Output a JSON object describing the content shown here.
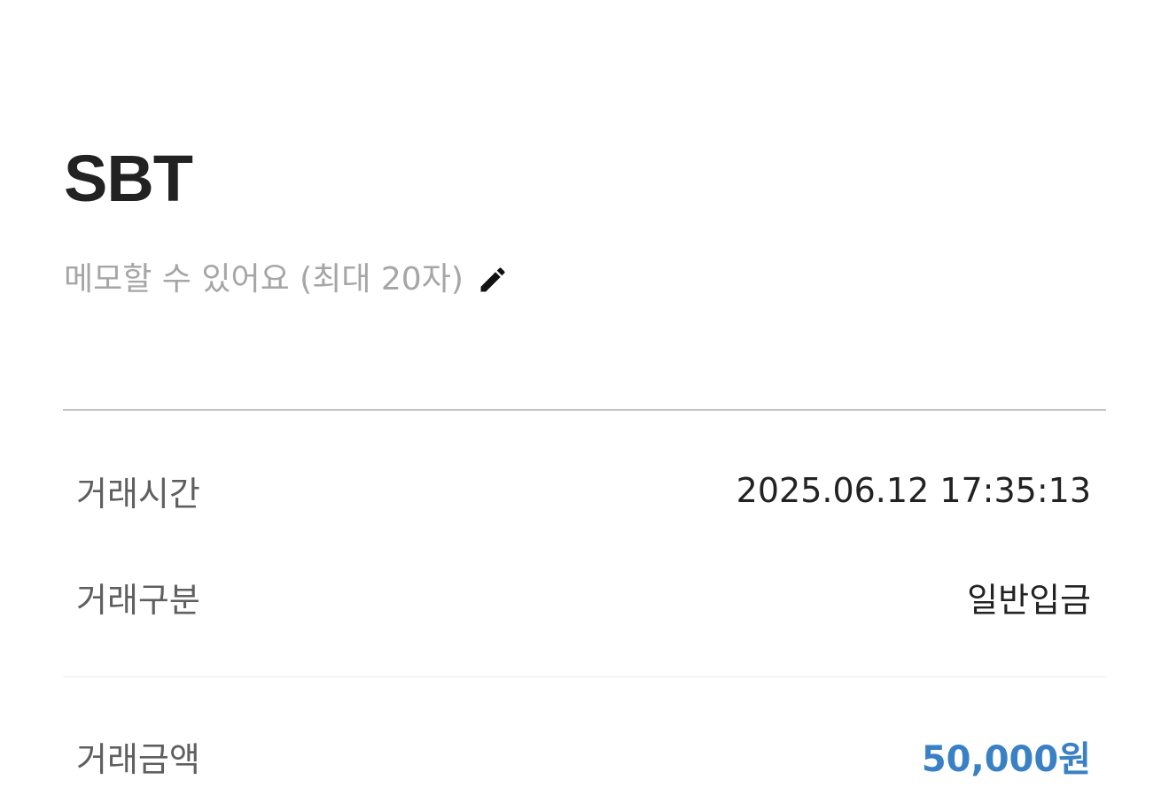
{
  "header": {
    "title": "SBT"
  },
  "memo": {
    "placeholder": "메모할 수 있어요 (최대 20자)",
    "icon": "pencil-icon"
  },
  "details": {
    "time": {
      "label": "거래시간",
      "value": "2025.06.12 17:35:13"
    },
    "type": {
      "label": "거래구분",
      "value": "일반입금"
    },
    "amount": {
      "label": "거래금액",
      "value": "50,000원"
    }
  },
  "colors": {
    "amount": "#3a80c4",
    "placeholder": "#a6a6a6",
    "title": "#222222"
  }
}
